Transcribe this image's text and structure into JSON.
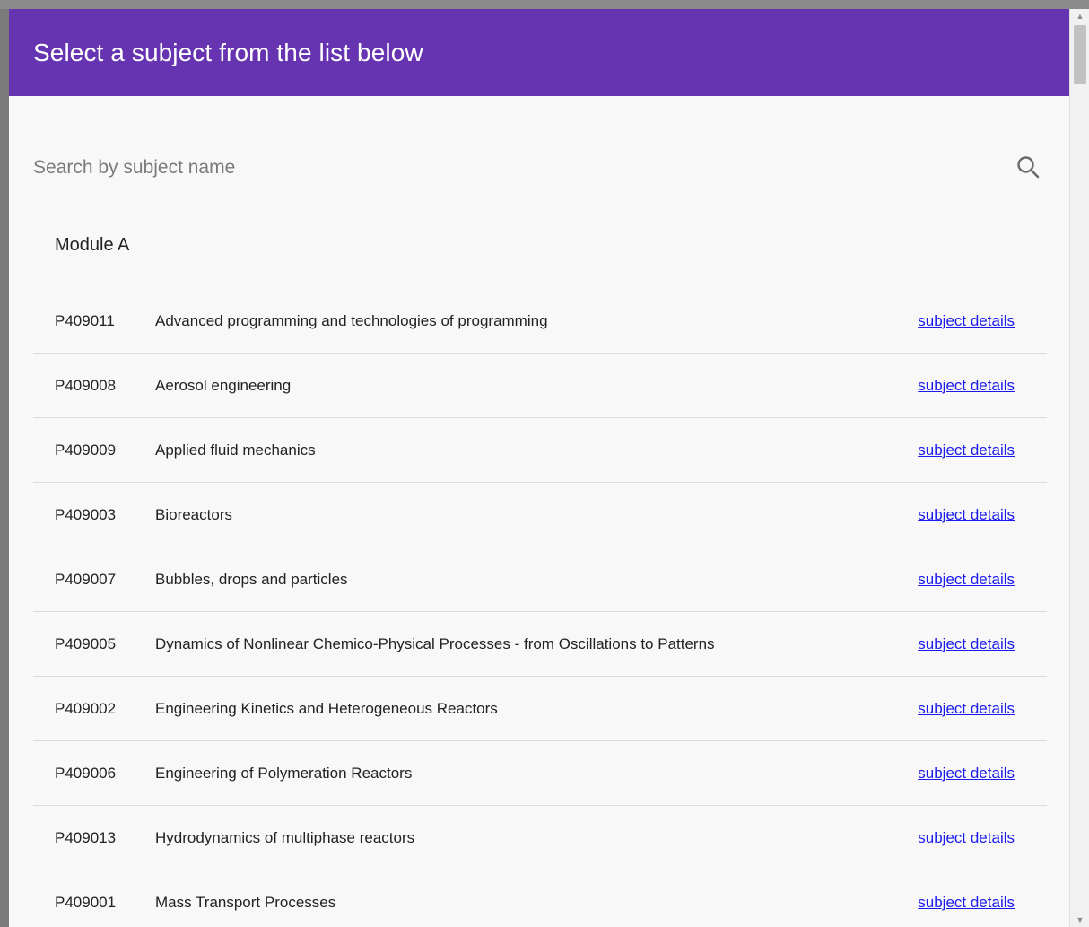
{
  "modal": {
    "title": "Select a subject from the list below"
  },
  "search": {
    "placeholder": "Search by subject name",
    "value": ""
  },
  "module": {
    "title": "Module A",
    "link_label": "subject details",
    "subjects": [
      {
        "code": "P409011",
        "name": "Advanced programming and technologies of programming"
      },
      {
        "code": "P409008",
        "name": "Aerosol engineering"
      },
      {
        "code": "P409009",
        "name": "Applied fluid mechanics"
      },
      {
        "code": "P409003",
        "name": "Bioreactors"
      },
      {
        "code": "P409007",
        "name": "Bubbles, drops and particles"
      },
      {
        "code": "P409005",
        "name": "Dynamics of Nonlinear Chemico-Physical Processes - from Oscillations to Patterns"
      },
      {
        "code": "P409002",
        "name": "Engineering Kinetics and Heterogeneous Reactors"
      },
      {
        "code": "P409006",
        "name": "Engineering of Polymeration Reactors"
      },
      {
        "code": "P409013",
        "name": "Hydrodynamics of multiphase reactors"
      },
      {
        "code": "P409001",
        "name": "Mass Transport Processes"
      }
    ]
  },
  "colors": {
    "header": "#6634b1",
    "link": "#1a1aee",
    "background": "#f8f8f8"
  }
}
